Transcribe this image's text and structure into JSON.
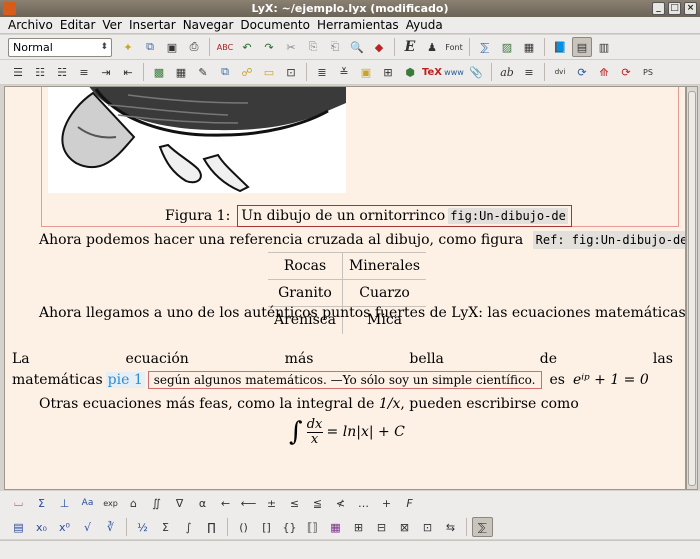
{
  "window": {
    "title": "LyX: ~/ejemplo.lyx (modificado)"
  },
  "menu": [
    "Archivo",
    "Editar",
    "Ver",
    "Insertar",
    "Navegar",
    "Documento",
    "Herramientas",
    "Ayuda"
  ],
  "toolbar1": {
    "layout_value": "Normal",
    "font_label": "Font"
  },
  "toolbar2": {
    "tex_label": "TeX",
    "ab_label": "ab",
    "ps_label": "PS",
    "dvi_label": "dvi"
  },
  "document": {
    "figure_label": "Figura 1:",
    "figure_caption": "Un dibujo de un ornitorrinco",
    "figure_label_key": "fig:Un-dibujo-de",
    "para1_text": "Ahora podemos hacer una referencia cruzada al dibujo, como figura",
    "para1_ref": "Ref: fig:Un-dibujo-de",
    "para1_end": ".",
    "table": [
      [
        "Rocas",
        "Minerales"
      ],
      [
        "Granito",
        "Cuarzo"
      ],
      [
        "Arenisca",
        "Mica"
      ]
    ],
    "para2_line1": "Ahora llegamos a uno de los auténticos puntos fuertes de LyX: las ecuaciones matemáticas.",
    "para2_line2_words": [
      "La",
      "ecuación",
      "más",
      "bella",
      "de",
      "las"
    ],
    "para2_line3_start": "matemáticas",
    "footnote_tag": "pie 1",
    "footnote_text": "según algunos matemáticos. —Yo sólo soy un simple científico.",
    "para2_line3_end": "es",
    "euler_eq": "eⁱᵖ + 1 = 0",
    "para3_text": "Otras ecuaciones más feas, como la integral de",
    "para3_math": "1/x",
    "para3_end": ", pueden escribirse como",
    "integral_eq": "= ln|x| + C"
  }
}
